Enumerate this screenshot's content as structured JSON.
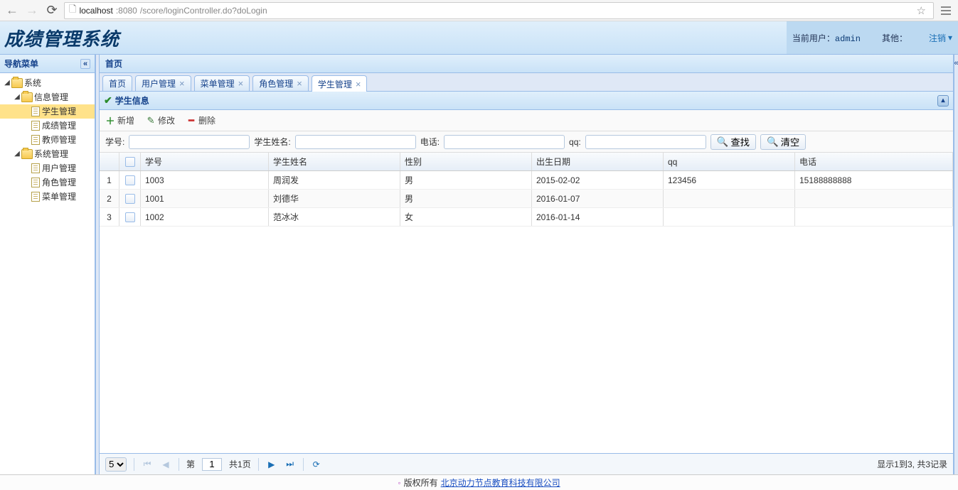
{
  "browser": {
    "url_host": "localhost",
    "url_port": ":8080",
    "url_path": "/score/loginController.do?doLogin"
  },
  "header": {
    "logo": "成绩管理系统",
    "current_user_label": "当前用户：",
    "current_user_value": "admin",
    "other_label": "其他：",
    "logout_label": "注销"
  },
  "sidebar": {
    "title": "导航菜单",
    "tree": {
      "system": "系统",
      "info_mgmt": "信息管理",
      "student_mgmt": "学生管理",
      "score_mgmt": "成绩管理",
      "teacher_mgmt": "教师管理",
      "sys_mgmt": "系统管理",
      "user_mgmt": "用户管理",
      "role_mgmt": "角色管理",
      "menu_mgmt": "菜单管理"
    }
  },
  "main": {
    "header": "首页",
    "tabs": [
      {
        "label": "首页",
        "closable": false
      },
      {
        "label": "用户管理",
        "closable": true
      },
      {
        "label": "菜单管理",
        "closable": true
      },
      {
        "label": "角色管理",
        "closable": true
      },
      {
        "label": "学生管理",
        "closable": true,
        "active": true
      }
    ],
    "panel_title": "学生信息",
    "toolbar": {
      "add": "新增",
      "edit": "修改",
      "del": "删除"
    },
    "search": {
      "sid_label": "学号:",
      "name_label": "学生姓名:",
      "tel_label": "电话:",
      "qq_label": "qq:",
      "search_btn": "查找",
      "clear_btn": "清空"
    },
    "grid": {
      "cols": {
        "sid": "学号",
        "name": "学生姓名",
        "sex": "性别",
        "birth": "出生日期",
        "qq": "qq",
        "tel": "电话"
      },
      "rows": [
        {
          "n": "1",
          "sid": "1003",
          "name": "周润发",
          "sex": "男",
          "birth": "2015-02-02",
          "qq": "123456",
          "tel": "15188888888"
        },
        {
          "n": "2",
          "sid": "1001",
          "name": "刘德华",
          "sex": "男",
          "birth": "2016-01-07",
          "qq": "",
          "tel": ""
        },
        {
          "n": "3",
          "sid": "1002",
          "name": "范冰冰",
          "sex": "女",
          "birth": "2016-01-14",
          "qq": "",
          "tel": ""
        }
      ]
    },
    "paging": {
      "page_size": "5",
      "page_label_prefix": "第",
      "page_value": "1",
      "page_total": "共1页",
      "summary": "显示1到3, 共3记录"
    }
  },
  "footer": {
    "copyright": "版权所有",
    "link": "北京动力节点教育科技有限公司"
  }
}
